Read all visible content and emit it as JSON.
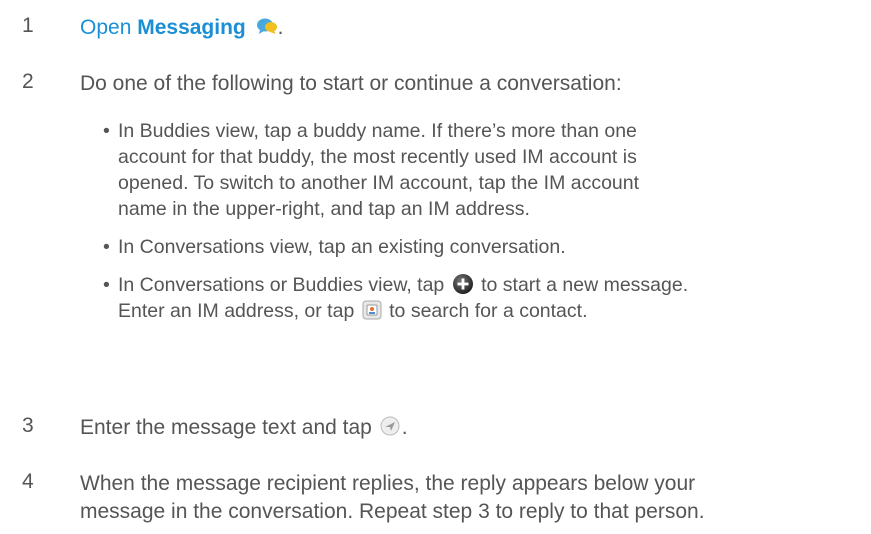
{
  "steps": [
    {
      "number": "1",
      "link_prefix": "Open",
      "link_bold": "Messaging",
      "suffix": ".",
      "icon": "messaging-app-icon"
    },
    {
      "number": "2",
      "text": "Do one of the following to start or continue a conversation:"
    },
    {
      "number": "3",
      "text_before": "Enter the message text and tap",
      "text_after": ".",
      "icon": "send-icon"
    },
    {
      "number": "4",
      "line1": "When the message recipient replies, the reply appears below your",
      "line2": "message in the conversation. Repeat step 3 to reply to that person."
    }
  ],
  "bullets": [
    {
      "line1": "In Buddies view, tap a buddy name. If there’s more than one",
      "line2": "account for that buddy, the most recently used IM account is",
      "line3": "opened. To switch to another IM account, tap the IM account",
      "line4": "name in the upper-right, and tap an IM address."
    },
    {
      "text": "In Conversations view, tap an existing conversation."
    },
    {
      "part1": "In Conversations or Buddies view, tap",
      "part2": "to start a new message.",
      "part3": "Enter an IM address, or tap",
      "part4": "to search for a contact.",
      "icon_a": "new-message-icon",
      "icon_b": "contacts-icon"
    }
  ],
  "colors": {
    "text": "#555555",
    "link": "#1a8fd6"
  }
}
